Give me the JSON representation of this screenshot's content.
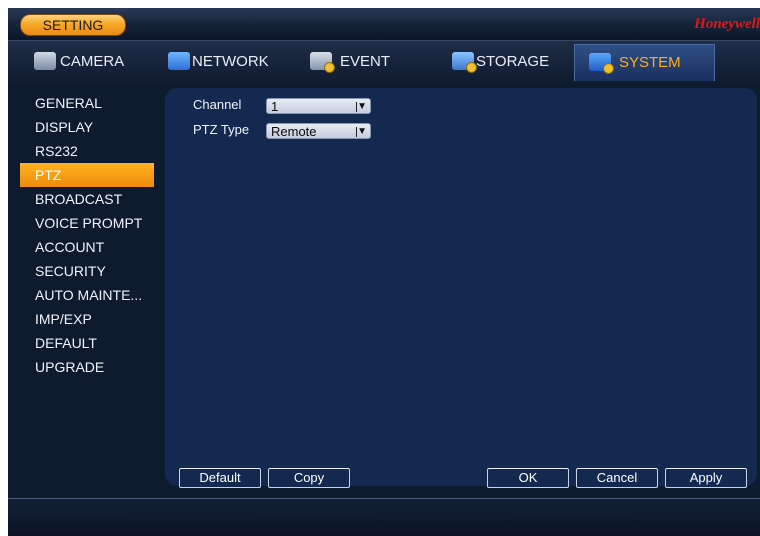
{
  "window": {
    "title_button": "SETTING",
    "brand": "Honeywell"
  },
  "tabs": [
    {
      "label": "CAMERA",
      "icon": "camera-icon"
    },
    {
      "label": "NETWORK",
      "icon": "network-icon"
    },
    {
      "label": "EVENT",
      "icon": "event-icon"
    },
    {
      "label": "STORAGE",
      "icon": "storage-icon"
    },
    {
      "label": "SYSTEM",
      "icon": "system-icon",
      "active": true
    }
  ],
  "sidebar": {
    "items": [
      {
        "label": "GENERAL"
      },
      {
        "label": "DISPLAY"
      },
      {
        "label": "RS232"
      },
      {
        "label": "PTZ",
        "active": true
      },
      {
        "label": "BROADCAST"
      },
      {
        "label": "VOICE PROMPT"
      },
      {
        "label": "ACCOUNT"
      },
      {
        "label": "SECURITY"
      },
      {
        "label": "AUTO MAINTE..."
      },
      {
        "label": "IMP/EXP"
      },
      {
        "label": "DEFAULT"
      },
      {
        "label": "UPGRADE"
      }
    ]
  },
  "form": {
    "channel_label": "Channel",
    "channel_value": "1",
    "ptz_type_label": "PTZ Type",
    "ptz_type_value": "Remote"
  },
  "buttons": {
    "default": "Default",
    "copy": "Copy",
    "ok": "OK",
    "cancel": "Cancel",
    "apply": "Apply"
  },
  "colors": {
    "accent": "#F5A623",
    "active_tab_text": "#FFAE1A",
    "panel_bg": "#13294F",
    "brand_red": "#E01818"
  }
}
